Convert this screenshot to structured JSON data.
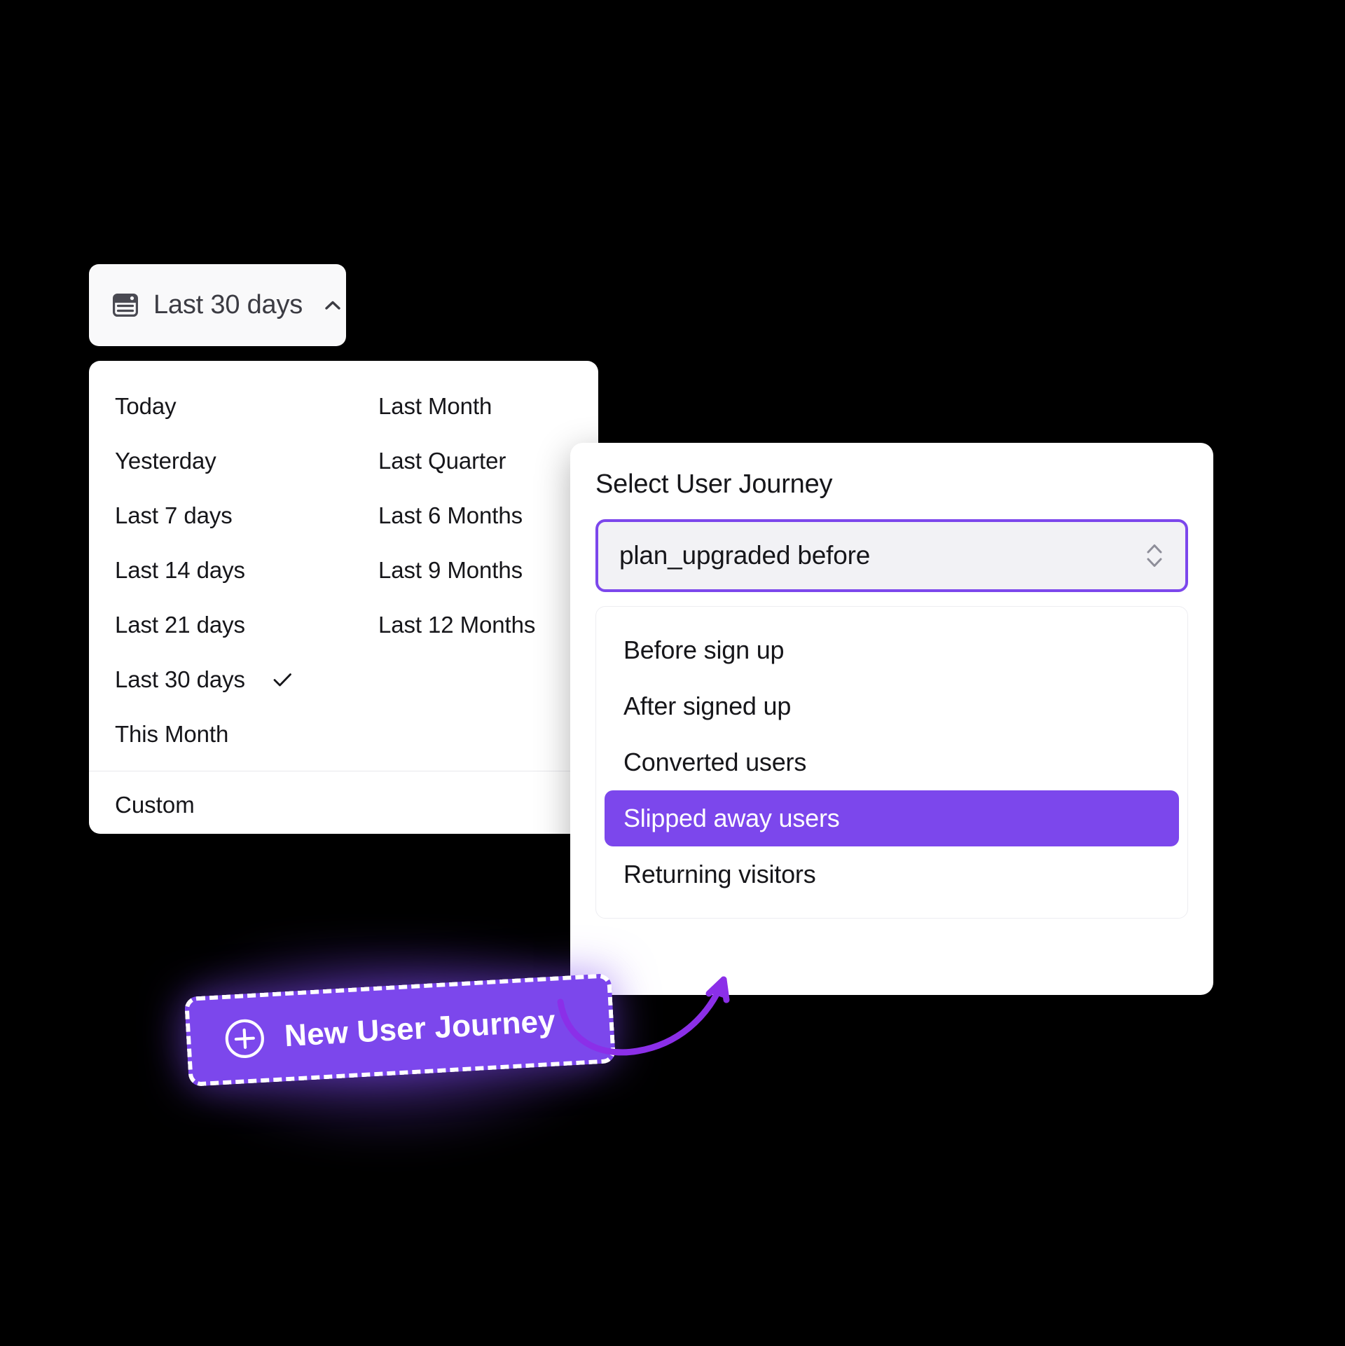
{
  "date_picker": {
    "trigger": {
      "icon": "calendar-icon",
      "label": "Last 30 days",
      "chevron": "chevron-up-icon"
    },
    "column_left": [
      {
        "label": "Today",
        "checked": false
      },
      {
        "label": "Yesterday",
        "checked": false
      },
      {
        "label": "Last 7 days",
        "checked": false
      },
      {
        "label": "Last 14 days",
        "checked": false
      },
      {
        "label": "Last 21 days",
        "checked": false
      },
      {
        "label": "Last 30 days",
        "checked": true
      },
      {
        "label": "This Month",
        "checked": false
      }
    ],
    "column_right": [
      {
        "label": "Last Month"
      },
      {
        "label": "Last Quarter"
      },
      {
        "label": "Last 6 Months"
      },
      {
        "label": "Last 9 Months"
      },
      {
        "label": "Last 12 Months"
      }
    ],
    "footer": {
      "label": "Custom"
    },
    "selected_value": "Last 30 days",
    "check_icon": "check-icon"
  },
  "journey_panel": {
    "title": "Select User Journey",
    "select": {
      "value": "plan_upgraded before",
      "stepper_icon": "chevron-up-down-icon"
    },
    "options": [
      {
        "label": "Before sign up",
        "selected": false
      },
      {
        "label": "After signed up",
        "selected": false
      },
      {
        "label": "Converted users",
        "selected": false
      },
      {
        "label": "Slipped away users",
        "selected": true
      },
      {
        "label": "Returning visitors",
        "selected": false
      }
    ]
  },
  "cta": {
    "label": "New User Journey",
    "icon": "plus-circle-icon"
  },
  "annotation": {
    "arrow_icon": "curved-arrow-icon"
  },
  "colors": {
    "accent_purple": "#7C47EC",
    "panel_white": "#FFFFFF",
    "background": "#000000",
    "text_primary": "#16161A",
    "trigger_bg": "#F9F9FA",
    "select_bg": "#F2F2F5"
  }
}
